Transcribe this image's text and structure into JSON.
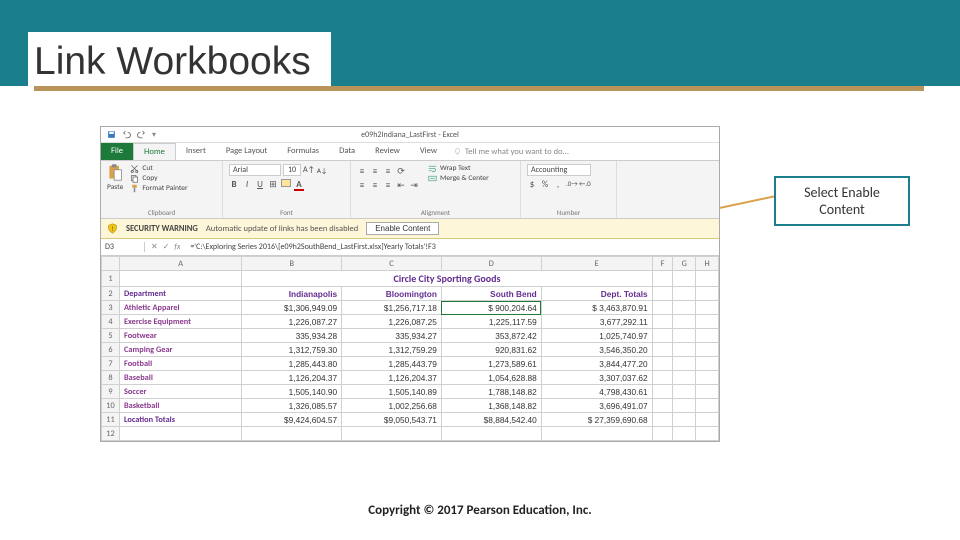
{
  "slide": {
    "title": "Link Workbooks",
    "copyright": "Copyright © 2017 Pearson Education, Inc."
  },
  "callout": {
    "text1": "Select Enable",
    "text2": "Content"
  },
  "window": {
    "title": "e09h2Indiana_LastFirst - Excel"
  },
  "tabs": {
    "file": "File",
    "home": "Home",
    "insert": "Insert",
    "pagelayout": "Page Layout",
    "formulas": "Formulas",
    "data": "Data",
    "review": "Review",
    "view": "View",
    "tell": "Tell me what you want to do..."
  },
  "ribbon": {
    "clipboard": {
      "label": "Clipboard",
      "paste": "Paste",
      "cut": "Cut",
      "copy": "Copy",
      "painter": "Format Painter"
    },
    "font": {
      "label": "Font",
      "name": "Arial",
      "size": "10"
    },
    "alignment": {
      "label": "Alignment",
      "wrap": "Wrap Text",
      "merge": "Merge & Center"
    },
    "number": {
      "label": "Number",
      "format": "Accounting"
    }
  },
  "security": {
    "caption": "SECURITY WARNING",
    "message": "Automatic update of links has been disabled",
    "button": "Enable Content"
  },
  "formula_bar": {
    "cell": "D3",
    "formula": "='C:\\Exploring Series 2016\\[e09h2SouthBend_LastFirst.xlsx]Yearly Totals'!F3"
  },
  "sheet": {
    "columns": [
      "A",
      "B",
      "C",
      "D",
      "E",
      "F",
      "G",
      "H"
    ],
    "title": "Circle City Sporting Goods",
    "headers": {
      "a": "Department",
      "b": "Indianapolis",
      "c": "Bloomington",
      "d": "South Bend",
      "e": "Dept. Totals"
    },
    "rows": [
      {
        "n": "3",
        "label": "Athletic Apparel",
        "b": "$1,306,949.09",
        "c": "$1,256,717.18",
        "d": "$  900,204.64",
        "e": "$  3,463,870.91"
      },
      {
        "n": "4",
        "label": "Exercise Equipment",
        "b": "1,226,087.27",
        "c": "1,226,087.25",
        "d": "1,225,117.59",
        "e": "3,677,292.11"
      },
      {
        "n": "5",
        "label": "Footwear",
        "b": "335,934.28",
        "c": "335,934.27",
        "d": "353,872.42",
        "e": "1,025,740.97"
      },
      {
        "n": "6",
        "label": "Camping Gear",
        "b": "1,312,759.30",
        "c": "1,312,759.29",
        "d": "920,831.62",
        "e": "3,546,350.20"
      },
      {
        "n": "7",
        "label": "Football",
        "b": "1,285,443.80",
        "c": "1,285,443.79",
        "d": "1,273,589.61",
        "e": "3,844,477.20"
      },
      {
        "n": "8",
        "label": "Baseball",
        "b": "1,126,204.37",
        "c": "1,126,204.37",
        "d": "1,054,628.88",
        "e": "3,307,037.62"
      },
      {
        "n": "9",
        "label": "Soccer",
        "b": "1,505,140.90",
        "c": "1,505,140.89",
        "d": "1,788,148.82",
        "e": "4,798,430.61"
      },
      {
        "n": "10",
        "label": "Basketball",
        "b": "1,326,085.57",
        "c": "1,002,256.68",
        "d": "1,368,148.82",
        "e": "3,696,491.07"
      }
    ],
    "totals": {
      "n": "11",
      "label": "Location Totals",
      "b": "$9,424,604.57",
      "c": "$9,050,543.71",
      "d": "$8,884,542.40",
      "e": "$ 27,359,690.68"
    }
  }
}
